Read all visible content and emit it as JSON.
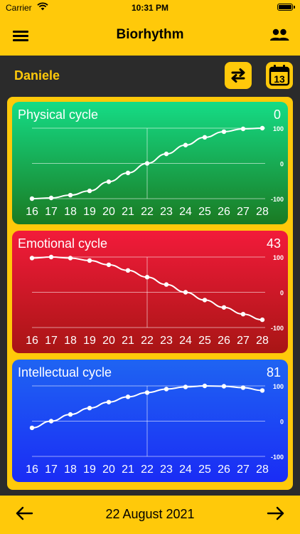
{
  "status_bar": {
    "carrier": "Carrier",
    "time": "10:31 PM"
  },
  "nav": {
    "title": "Biorhythm",
    "menu_icon": "hamburger-menu-icon",
    "people_icon": "people-icon"
  },
  "user": {
    "name": "Daniele",
    "swap_icon": "swap-arrows-icon",
    "calendar_icon": "calendar-icon",
    "calendar_day": "13"
  },
  "colors": {
    "accent": "#FFC90A",
    "background": "#2b2b2b"
  },
  "chart_data": [
    {
      "type": "line",
      "title": "Physical cycle",
      "value": "0",
      "x": [
        "16",
        "17",
        "18",
        "19",
        "20",
        "21",
        "22",
        "23",
        "24",
        "25",
        "26",
        "27",
        "28"
      ],
      "values": [
        -100,
        -98,
        -90,
        -78,
        -52,
        -27,
        0,
        27,
        52,
        74,
        90,
        98,
        100
      ],
      "y_ticks": [
        "100",
        "0",
        "-100"
      ],
      "ylim": [
        -100,
        100
      ],
      "highlight_x": "22",
      "gradient": [
        "#15DC86",
        "#1A7A22"
      ]
    },
    {
      "type": "line",
      "title": "Emotional cycle",
      "value": "43",
      "x": [
        "16",
        "17",
        "18",
        "19",
        "20",
        "21",
        "22",
        "23",
        "24",
        "25",
        "26",
        "27",
        "28"
      ],
      "values": [
        97,
        100,
        97,
        90,
        78,
        62,
        43,
        22,
        0,
        -22,
        -43,
        -62,
        -78
      ],
      "y_ticks": [
        "100",
        "0",
        "-100"
      ],
      "ylim": [
        -100,
        100
      ],
      "highlight_x": "22",
      "gradient": [
        "#F21B3A",
        "#A81515"
      ]
    },
    {
      "type": "line",
      "title": "Intellectual cycle",
      "value": "81",
      "x": [
        "16",
        "17",
        "18",
        "19",
        "20",
        "21",
        "22",
        "23",
        "24",
        "25",
        "26",
        "27",
        "28"
      ],
      "values": [
        -19,
        0,
        19,
        37,
        54,
        69,
        81,
        91,
        97,
        100,
        99,
        95,
        87
      ],
      "y_ticks": [
        "100",
        "0",
        "-100"
      ],
      "ylim": [
        -100,
        100
      ],
      "highlight_x": "22",
      "gradient": [
        "#1F64F2",
        "#1A2CF5"
      ]
    }
  ],
  "footer": {
    "date": "22 August 2021",
    "prev_icon": "arrow-left-icon",
    "next_icon": "arrow-right-icon"
  }
}
